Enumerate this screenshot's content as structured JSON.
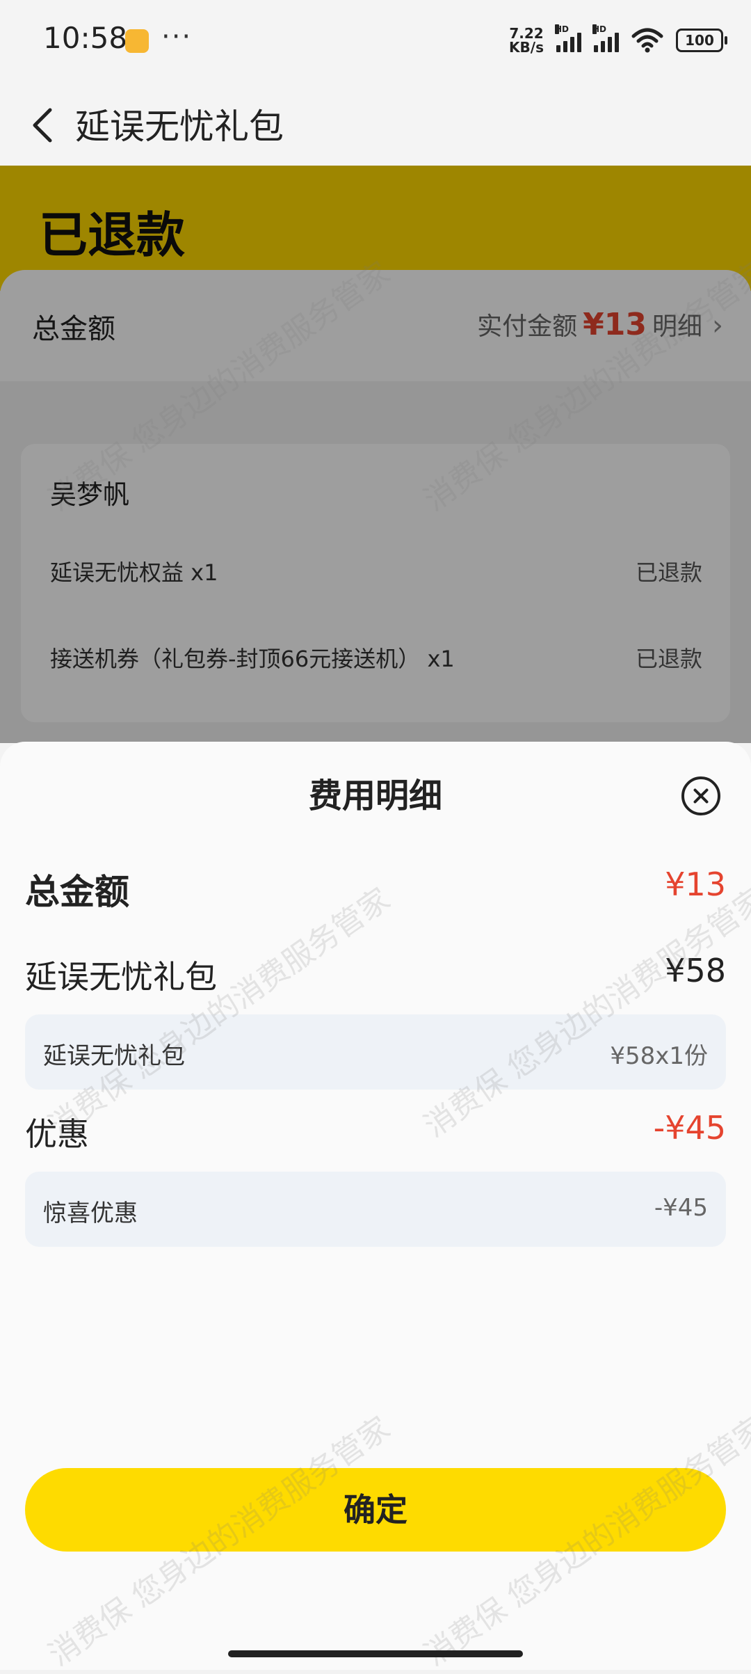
{
  "status_bar": {
    "time": "10:58",
    "dots": "···",
    "speed_value": "7.22",
    "speed_unit": "KB/s",
    "hd_label": "HD",
    "battery": "100"
  },
  "nav": {
    "title": "延误无忧礼包"
  },
  "page": {
    "status_title": "已退款",
    "total_label": "总金额",
    "paid_label": "实付金额",
    "paid_amount": "¥13",
    "detail_link": "明细",
    "passenger_name": "吴梦帆",
    "items": [
      {
        "name": "延误无忧权益 x1",
        "status": "已退款"
      },
      {
        "name": "接送机券（礼包券-封顶66元接送机） x1",
        "status": "已退款"
      }
    ]
  },
  "sheet": {
    "title": "费用明细",
    "total_label": "总金额",
    "total_value": "¥13",
    "package_label": "延误无忧礼包",
    "package_value": "¥58",
    "package_detail_label": "延误无忧礼包",
    "package_detail_value": "¥58x1份",
    "discount_label": "优惠",
    "discount_value": "-¥45",
    "discount_detail_label": "惊喜优惠",
    "discount_detail_value": "-¥45",
    "confirm_label": "确定"
  },
  "watermark": "消费保 您身边的消费服务管家",
  "colors": {
    "accent_yellow": "#fedb00",
    "price_red": "#e5442f"
  }
}
